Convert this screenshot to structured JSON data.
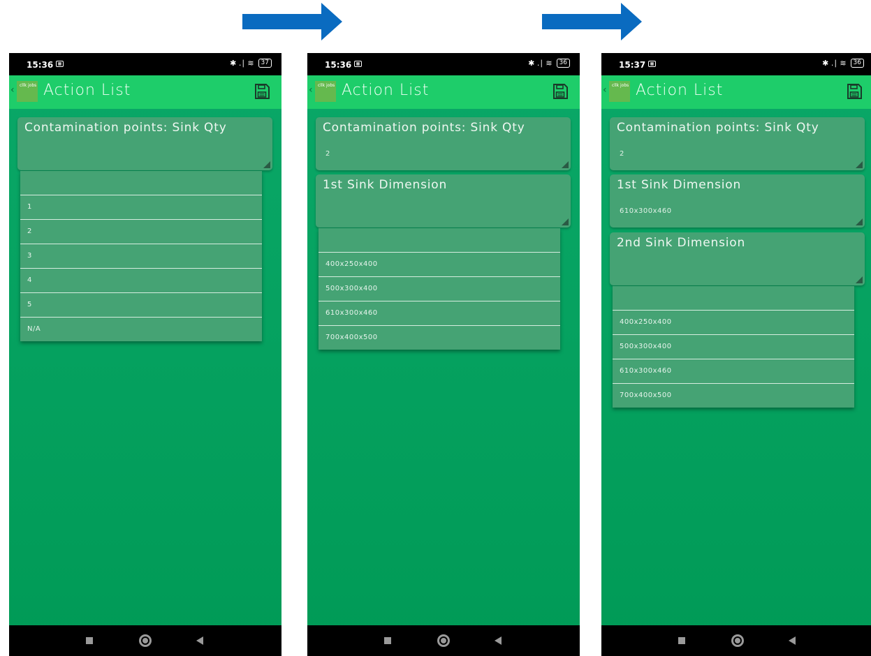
{
  "colors": {
    "arrow": "#0a6bc0",
    "appbar": "#1ecd6a",
    "background": "#009a56",
    "card": "#45a374"
  },
  "screens": [
    {
      "status": {
        "time": "15:36",
        "notif": "▦",
        "signal": "✱ .∣ ≋",
        "battery": "37"
      },
      "appbar": {
        "back": "‹",
        "logo": "cllk jobs",
        "title": "Action List",
        "save_icon": "save-icon"
      },
      "fields": [
        {
          "label": "Contamination points: Sink Qty",
          "value": ""
        }
      ],
      "dropdown": [
        "",
        "1",
        "2",
        "3",
        "4",
        "5",
        "N/A"
      ]
    },
    {
      "status": {
        "time": "15:36",
        "notif": "▦",
        "signal": "✱ .∣ ≋",
        "battery": "36"
      },
      "appbar": {
        "back": "‹",
        "logo": "cllk jobs",
        "title": "Action List",
        "save_icon": "save-icon"
      },
      "fields": [
        {
          "label": "Contamination points: Sink Qty",
          "value": "2"
        },
        {
          "label": "1st Sink Dimension",
          "value": ""
        }
      ],
      "dropdown": [
        "",
        "400x250x400",
        "500x300x400",
        "610x300x460",
        "700x400x500"
      ]
    },
    {
      "status": {
        "time": "15:37",
        "notif": "▦",
        "signal": "✱ .∣ ≋",
        "battery": "36"
      },
      "appbar": {
        "back": "‹",
        "logo": "cllk jobs",
        "title": "Action List",
        "save_icon": "save-icon"
      },
      "fields": [
        {
          "label": "Contamination points: Sink Qty",
          "value": "2"
        },
        {
          "label": "1st Sink Dimension",
          "value": "610x300x460"
        },
        {
          "label": "2nd Sink Dimension",
          "value": ""
        }
      ],
      "dropdown": [
        "",
        "400x250x400",
        "500x300x400",
        "610x300x460",
        "700x400x500"
      ]
    }
  ]
}
